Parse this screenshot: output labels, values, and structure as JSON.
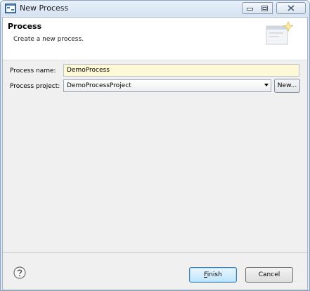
{
  "window": {
    "title": "New Process",
    "icon": "process-wizard-icon",
    "controls": [
      "minimize-icon",
      "maximize-icon",
      "close-icon"
    ]
  },
  "header": {
    "title": "Process",
    "description": "Create a new process.",
    "graphic": "new-wizard-banner-icon"
  },
  "form": {
    "process_name_label": "Process name:",
    "process_name_value": "DemoProcess",
    "process_project_label": "Process project:",
    "process_project_value": "DemoProcessProject",
    "new_button_label": "New..."
  },
  "footer": {
    "help_icon": "help-icon",
    "finish_mnemonic": "F",
    "finish_rest": "inish",
    "cancel_label": "Cancel"
  },
  "colors": {
    "name_field_bg": "#fdf8d6",
    "finish_button": "#bee6fd",
    "titlebar": "#dbe7f4"
  }
}
